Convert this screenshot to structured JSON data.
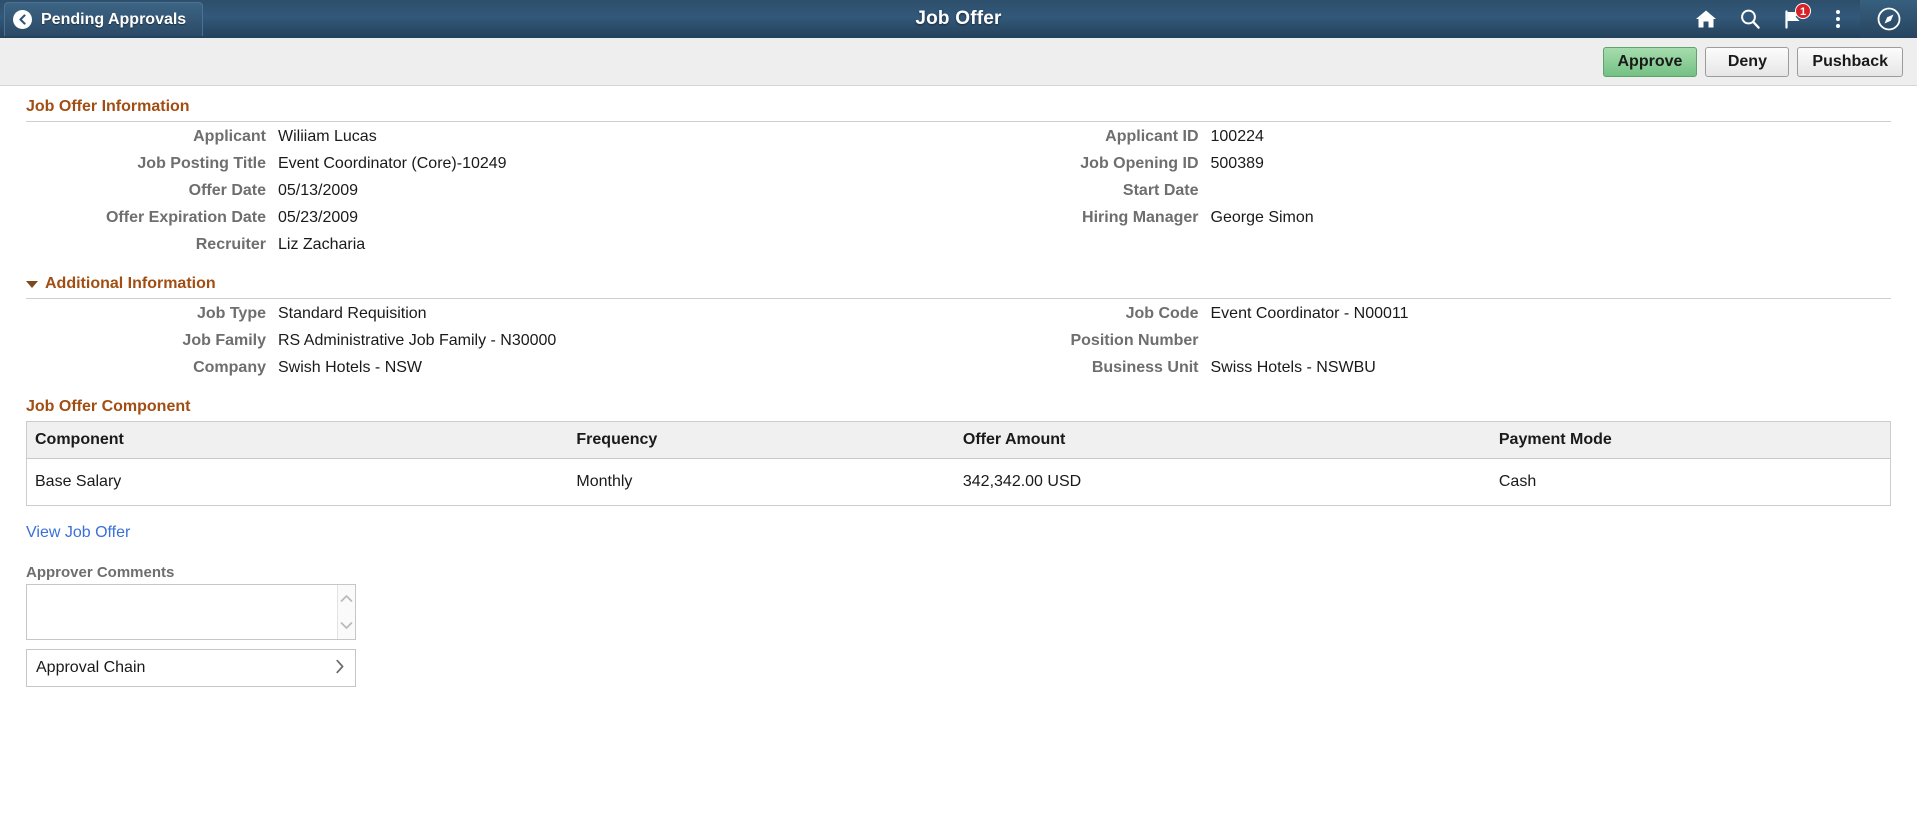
{
  "header": {
    "back_label": "Pending Approvals",
    "title": "Job Offer",
    "notification_count": "1",
    "icons": {
      "home": "home-icon",
      "search": "search-icon",
      "notifications": "flag-notification-icon",
      "actions": "three-dot-menu-icon",
      "nav": "navigator-compass-icon"
    }
  },
  "toolbar": {
    "approve_label": "Approve",
    "deny_label": "Deny",
    "pushback_label": "Pushback",
    "approve_color": "#74c184"
  },
  "job_offer_information": {
    "heading": "Job Offer Information",
    "left": [
      {
        "label": "Applicant",
        "value": "Wiliiam Lucas"
      },
      {
        "label": "Job Posting Title",
        "value": "Event Coordinator (Core)-10249"
      },
      {
        "label": "Offer Date",
        "value": "05/13/2009"
      },
      {
        "label": "Offer Expiration Date",
        "value": "05/23/2009"
      },
      {
        "label": "Recruiter",
        "value": "Liz Zacharia"
      }
    ],
    "right": [
      {
        "label": "Applicant ID",
        "value": "100224"
      },
      {
        "label": "Job Opening ID",
        "value": "500389"
      },
      {
        "label": "Start Date",
        "value": ""
      },
      {
        "label": "Hiring Manager",
        "value": "George Simon"
      }
    ]
  },
  "additional_information": {
    "heading": "Additional Information",
    "expanded": true,
    "left": [
      {
        "label": "Job Type",
        "value": "Standard Requisition"
      },
      {
        "label": "Job Family",
        "value": "RS Administrative Job Family - N30000"
      },
      {
        "label": "Company",
        "value": "Swish Hotels - NSW"
      }
    ],
    "right": [
      {
        "label": "Job Code",
        "value": "Event Coordinator - N00011"
      },
      {
        "label": "Position Number",
        "value": ""
      },
      {
        "label": "Business Unit",
        "value": "Swiss Hotels - NSWBU"
      }
    ]
  },
  "job_offer_component": {
    "heading": "Job Offer Component",
    "columns": [
      "Component",
      "Frequency",
      "Offer Amount",
      "Payment Mode"
    ],
    "rows": [
      [
        "Base Salary",
        "Monthly",
        "342,342.00 USD",
        "Cash"
      ]
    ]
  },
  "footer": {
    "view_job_offer_link": "View Job Offer",
    "approver_comments_label": "Approver Comments",
    "approver_comments_value": "",
    "approver_comments_placeholder": "",
    "approval_chain_label": "Approval Chain"
  }
}
